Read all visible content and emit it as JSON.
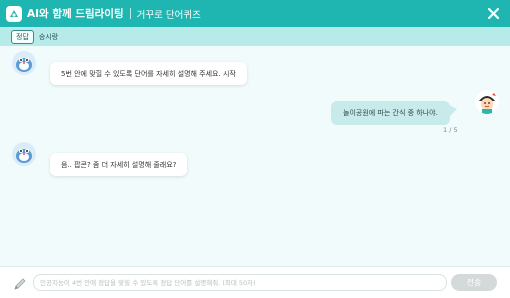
{
  "header": {
    "app_title": "AI와 함께 드림라이팅",
    "sub_title": "거꾸로 단어퀴즈"
  },
  "tabs": {
    "answer_label": "정답",
    "win_label": "승시랑"
  },
  "messages": [
    {
      "sender": "bot",
      "text": "5번 안에 맞힐 수 있도록 단어를 자세히 설명해 주세요. 시작"
    },
    {
      "sender": "user",
      "text": "놀이공원에 파는 간식 중 하나야."
    },
    {
      "sender": "bot",
      "text": "음.. 팝콘? 좀 더 자세히 설명해 줄래요?"
    }
  ],
  "counter": "1 / 5",
  "input": {
    "placeholder": "인공지능이 4번 안에 정답을 맞힐 수 있도록 정답 단어를 설명해줘. (최대 50자)",
    "value": ""
  },
  "send_label": "전송",
  "colors": {
    "header": "#1fb5b0",
    "tab_row": "#b7ebe9",
    "user_bubble": "#c6ebea",
    "send_disabled": "#d4d9d9"
  },
  "icons": {
    "logo": "app-logo-icon",
    "close": "close-icon",
    "bot_avatar": "robot-avatar-icon",
    "user_avatar": "child-avatar-icon",
    "pencil": "pencil-icon"
  }
}
